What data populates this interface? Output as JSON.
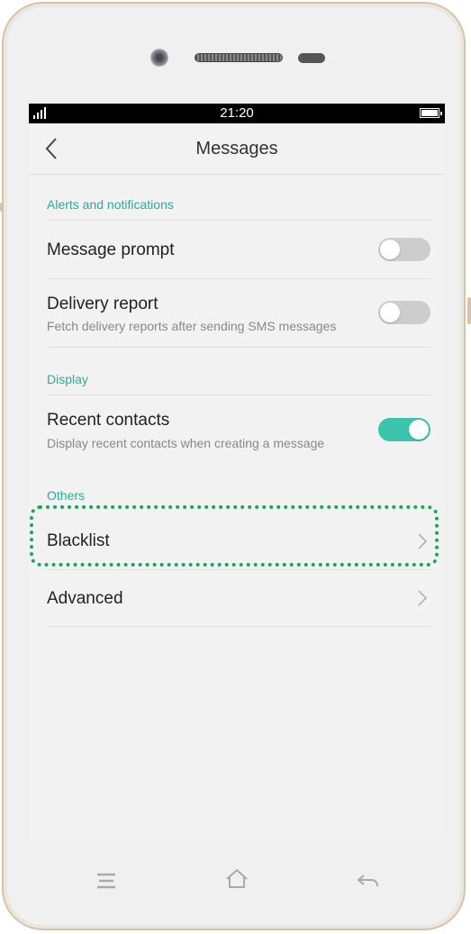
{
  "status_bar": {
    "time": "21:20"
  },
  "header": {
    "title": "Messages"
  },
  "sections": {
    "alerts": "Alerts and notifications",
    "display": "Display",
    "others": "Others"
  },
  "settings": {
    "message_prompt": {
      "title": "Message prompt",
      "enabled": false
    },
    "delivery_report": {
      "title": "Delivery report",
      "subtitle": "Fetch delivery reports after sending SMS messages",
      "enabled": false
    },
    "recent_contacts": {
      "title": "Recent contacts",
      "subtitle": "Display recent contacts when creating a message",
      "enabled": true
    },
    "blacklist": {
      "title": "Blacklist"
    },
    "advanced": {
      "title": "Advanced"
    }
  },
  "colors": {
    "accent": "#2eaa98",
    "toggle_on": "#3cc4ad",
    "toggle_off": "#cdcdcd",
    "highlight": "#1aa55a"
  }
}
